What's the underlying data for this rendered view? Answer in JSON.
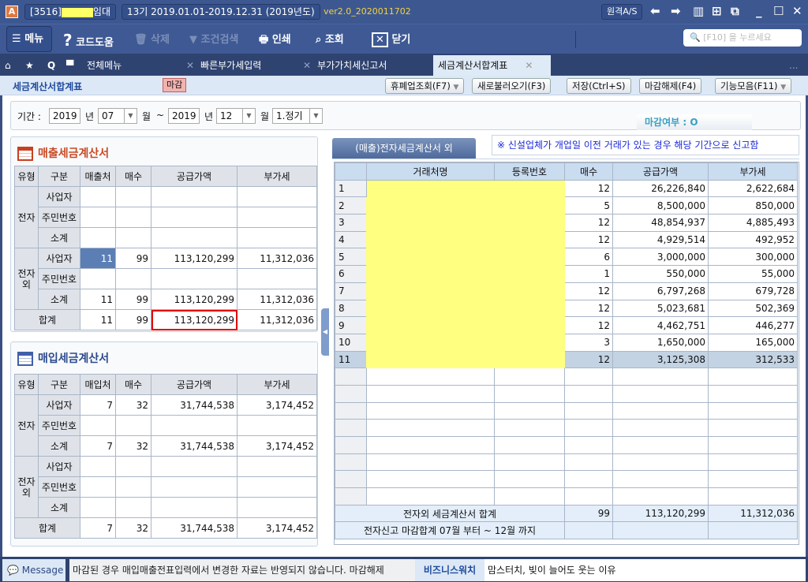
{
  "titlebar": {
    "app_icon": "A",
    "company_code": "[3516]",
    "company_suffix": "임대",
    "fiscal_period": "13기 2019.01.01-2019.12.31",
    "fiscal_year": "(2019년도)",
    "version": "ver2.0_2020011702",
    "remote_as": "원격A/S",
    "icons": [
      "arrow-left-icon",
      "arrow-right-icon",
      "book-icon",
      "grid-icon",
      "window-icon",
      "minimize-icon",
      "maximize-icon",
      "close-icon"
    ]
  },
  "toolbar": {
    "menu": "메뉴",
    "code_help": "코드도움",
    "delete": "삭제",
    "filter_search": "조건검색",
    "print": "인쇄",
    "inquiry": "조회",
    "close": "닫기",
    "search_placeholder": "[F10] 을 누르세요"
  },
  "tabs": {
    "all_menu": "전체메뉴",
    "t1": "빠른부가세입력",
    "t2": "부가가치세신고서",
    "t3": "세금계산서합계표",
    "more": "..."
  },
  "subheader": {
    "title": "세금계산서합계표",
    "badge": "마감",
    "buttons": [
      "휴폐업조회(F7)",
      "새로불러오기(F3)",
      "저장(Ctrl+S)",
      "마감해제(F4)",
      "기능모음(F11)"
    ]
  },
  "period": {
    "label": "기간 :",
    "from_year": "2019",
    "year_unit": "년",
    "from_month": "07",
    "month_unit": "월",
    "tilde": "~",
    "to_year": "2019",
    "to_month": "12",
    "report_type": "1.정기",
    "closed_label": "마감여부 :",
    "closed_mark": "O"
  },
  "sales": {
    "title": "매출세금계산서",
    "headers": [
      "유형",
      "구분",
      "매출처",
      "매수",
      "공급가액",
      "부가세"
    ],
    "groups": [
      {
        "type": "전자",
        "rows": [
          [
            "사업자",
            "",
            "",
            "",
            ""
          ],
          [
            "주민번호",
            "",
            "",
            "",
            ""
          ],
          [
            "소계",
            "",
            "",
            "",
            ""
          ]
        ]
      },
      {
        "type": "전자외",
        "rows": [
          [
            "사업자",
            "11",
            "99",
            "113,120,299",
            "11,312,036"
          ],
          [
            "주민번호",
            "",
            "",
            "",
            ""
          ],
          [
            "소계",
            "11",
            "99",
            "113,120,299",
            "11,312,036"
          ]
        ]
      }
    ],
    "total": [
      "합계",
      "11",
      "99",
      "113,120,299",
      "11,312,036"
    ]
  },
  "purchase": {
    "title": "매입세금계산서",
    "headers": [
      "유형",
      "구분",
      "매입처",
      "매수",
      "공급가액",
      "부가세"
    ],
    "groups": [
      {
        "type": "전자",
        "rows": [
          [
            "사업자",
            "7",
            "32",
            "31,744,538",
            "3,174,452"
          ],
          [
            "주민번호",
            "",
            "",
            "",
            ""
          ],
          [
            "소계",
            "7",
            "32",
            "31,744,538",
            "3,174,452"
          ]
        ]
      },
      {
        "type": "전자외",
        "rows": [
          [
            "사업자",
            "",
            "",
            "",
            ""
          ],
          [
            "주민번호",
            "",
            "",
            "",
            ""
          ],
          [
            "소계",
            "",
            "",
            "",
            ""
          ]
        ]
      }
    ],
    "total": [
      "합계",
      "7",
      "32",
      "31,744,538",
      "3,174,452"
    ]
  },
  "right": {
    "tab": "(매출)전자세금계산서 외",
    "notice": "※ 신설업체가 개업일 이전 거래가 있는 경우 해당 기간으로 신고함",
    "headers": [
      "",
      "거래처명",
      "등록번호",
      "매수",
      "공급가액",
      "부가세"
    ],
    "rows": [
      [
        "1",
        "12",
        "26,226,840",
        "2,622,684"
      ],
      [
        "2",
        "5",
        "8,500,000",
        "850,000"
      ],
      [
        "3",
        "12",
        "48,854,937",
        "4,885,493"
      ],
      [
        "4",
        "12",
        "4,929,514",
        "492,952"
      ],
      [
        "5",
        "6",
        "3,000,000",
        "300,000"
      ],
      [
        "6",
        "1",
        "550,000",
        "55,000"
      ],
      [
        "7",
        "12",
        "6,797,268",
        "679,728"
      ],
      [
        "8",
        "12",
        "5,023,681",
        "502,369"
      ],
      [
        "9",
        "12",
        "4,462,751",
        "446,277"
      ],
      [
        "10",
        "3",
        "1,650,000",
        "165,000"
      ],
      [
        "11",
        "12",
        "3,125,308",
        "312,533"
      ]
    ],
    "summary": {
      "label": "전자외 세금계산서 합계",
      "count": "99",
      "supply": "113,120,299",
      "vat": "11,312,036"
    },
    "closing": {
      "label": "전자신고 마감합계 07월 부터 ~ 12월 까지"
    }
  },
  "status": {
    "message_btn": "Message",
    "message": "마감된 경우 매입매출전표입력에서 변경한 자료는 반영되지 않습니다. 마감해제",
    "biz": "비즈니스워치",
    "news": "맘스터치, 빚이 늘어도 웃는 이유"
  }
}
